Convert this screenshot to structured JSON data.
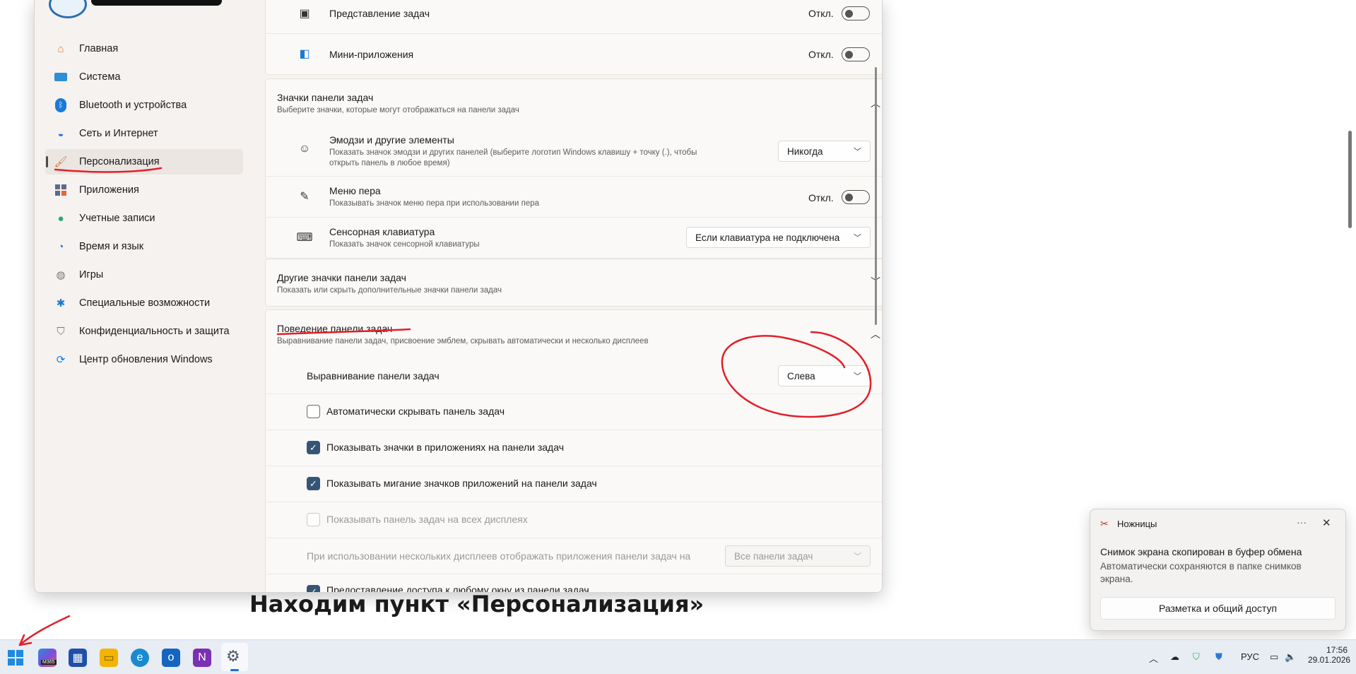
{
  "nav": {
    "items": [
      {
        "label": "Главная"
      },
      {
        "label": "Система"
      },
      {
        "label": "Bluetooth и устройства"
      },
      {
        "label": "Сеть и Интернет"
      },
      {
        "label": "Персонализация",
        "selected": true
      },
      {
        "label": "Приложения"
      },
      {
        "label": "Учетные записи"
      },
      {
        "label": "Время и язык"
      },
      {
        "label": "Игры"
      },
      {
        "label": "Специальные возможности"
      },
      {
        "label": "Конфиденциальность и защита"
      },
      {
        "label": "Центр обновления Windows"
      }
    ]
  },
  "content": {
    "task_view": {
      "title": "Представление задач",
      "state": "Откл."
    },
    "widgets": {
      "title": "Мини-приложения",
      "state": "Откл."
    },
    "taskbar_icons": {
      "title": "Значки панели задач",
      "subtitle": "Выберите значки, которые могут отображаться на панели задач"
    },
    "emoji": {
      "title": "Эмодзи и другие элементы",
      "subtitle1": "Показать значок эмодзи и других панелей (выберите логотип Windows клавишу + точку (.), чтобы",
      "subtitle2": "открыть панель в любое время)",
      "value": "Никогда"
    },
    "pen": {
      "title": "Меню пера",
      "subtitle": "Показывать значок меню пера при использовании пера",
      "state": "Откл."
    },
    "touch_keyboard": {
      "title": "Сенсорная клавиатура",
      "subtitle": "Показать значок сенсорной клавиатуры",
      "value": "Если клавиатура не подключена"
    },
    "other_icons": {
      "title": "Другие значки панели задач",
      "subtitle": "Показать или скрыть дополнительные значки панели задач"
    },
    "behaviors": {
      "title": "Поведение панели задач",
      "subtitle": "Выравнивание панели задач, присвоение эмблем, скрывать автоматически и несколько дисплеев",
      "alignment_label": "Выравнивание панели задач",
      "alignment_value": "Слева",
      "autohide": "Автоматически скрывать панель задач",
      "badges": "Показывать значки в приложениях на панели задач",
      "flashing": "Показывать мигание значков приложений на панели задач",
      "all_displays": "Показывать панель задач на всех дисплеях",
      "multi_label": "При использовании нескольких дисплеев отображать приложения панели задач на",
      "multi_value": "Все панели задач",
      "share_window": "Предоставление доступа к любому окну из панели задач"
    }
  },
  "caption": "Находим пункт «Персонализация»",
  "toast": {
    "app": "Ножницы",
    "more": "···",
    "title": "Снимок экрана скопирован в буфер обмена",
    "body": "Автоматически сохраняются в папке снимков экрана.",
    "button": "Разметка и общий доступ"
  },
  "taskbar": {
    "m365_badge": "M365",
    "language": "РУС",
    "time": "17:56",
    "date": "29.01.2026"
  },
  "colors": {
    "annotation": "#e0202a",
    "accent": "#0067c0",
    "checkbox_on": "#355576"
  }
}
